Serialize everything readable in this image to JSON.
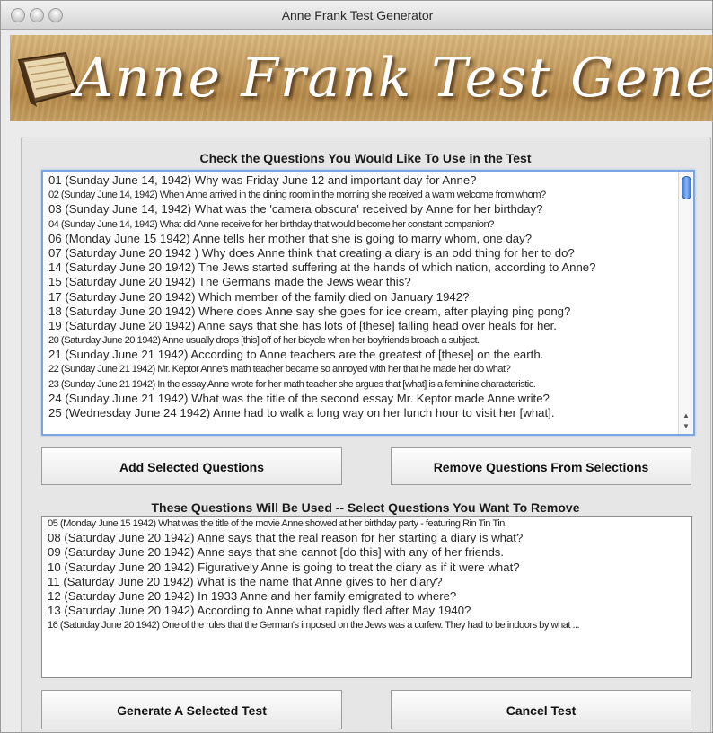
{
  "window": {
    "title": "Anne Frank Test Generator"
  },
  "banner": {
    "title": "Anne Frank Test Generator",
    "icon": "book-icon"
  },
  "available": {
    "label": "Check the Questions You Would Like To Use in the Test",
    "items": [
      "01 (Sunday June 14, 1942) Why was Friday June 12 and important day for Anne?",
      "02 (Sunday June 14, 1942) When Anne arrived in the dining room in the morning she received a warm welcome from whom?",
      "03 (Sunday June 14, 1942) What was the 'camera obscura' received by Anne for her birthday?",
      "04 (Sunday June 14, 1942) What did Anne receive for her birthday that would become her constant companion?",
      "06 (Monday June 15 1942) Anne tells her mother that she is going to marry whom, one day?",
      "07 (Saturday June 20 1942 ) Why does Anne think that creating a diary is an odd thing for her to do?",
      "14 (Saturday June 20 1942) The Jews started suffering at the hands of which nation, according to Anne?",
      "15 (Saturday June 20 1942) The Germans made the Jews wear this?",
      "17 (Saturday June 20 1942) Which member of the family died on January 1942?",
      "18 (Saturday June 20 1942) Where does Anne say she goes for ice cream, after playing ping pong?",
      "19 (Saturday June 20 1942) Anne says that she has lots of [these] falling head over heals for her.",
      "20 (Saturday June 20 1942) Anne usually drops [this] off of her bicycle when her boyfriends broach a subject.",
      "21 (Sunday June 21 1942) According to Anne teachers are the greatest of [these] on the earth.",
      "22 (Sunday June 21 1942) Mr. Keptor Anne's math teacher became so annoyed with her that he made her do what?",
      "23 (Sunday June 21 1942) In the essay Anne wrote for her math teacher she argues that [what] is a feminine characteristic.",
      "24 (Sunday June 21 1942) What was the title of the second essay Mr. Keptor made Anne write?",
      "25 (Wednesday June 24 1942) Anne had to walk a long way on her lunch hour to visit her [what]."
    ]
  },
  "actions": {
    "add_label": "Add Selected Questions",
    "remove_label": "Remove Questions From Selections"
  },
  "selected": {
    "label": "These Questions Will Be Used -- Select Questions You Want To Remove",
    "items": [
      "05 (Monday June 15 1942) What was the title of the movie Anne showed at her birthday party - featuring Rin Tin Tin.",
      "08 (Saturday June 20 1942) Anne says that the real reason for her starting a diary is what?",
      "09 (Saturday June 20 1942) Anne says that she cannot [do this] with any of her friends.",
      "10 (Saturday June 20 1942) Figuratively Anne is going to treat the diary as if it were what?",
      "11 (Saturday June 20 1942) What is the name that Anne gives to her diary?",
      "12 (Saturday June 20 1942) In 1933 Anne and her family emigrated to where?",
      "13 (Saturday June 20 1942) According to Anne what rapidly fled after May 1940?",
      "16 (Saturday June 20 1942) One of the rules that the German's imposed on the Jews was a curfew.  They had to be indoors by what ..."
    ]
  },
  "footer": {
    "generate_label": "Generate A Selected Test",
    "cancel_label": "Cancel Test"
  },
  "scroll": {
    "up_glyph": "▲",
    "down_glyph": "▼"
  }
}
